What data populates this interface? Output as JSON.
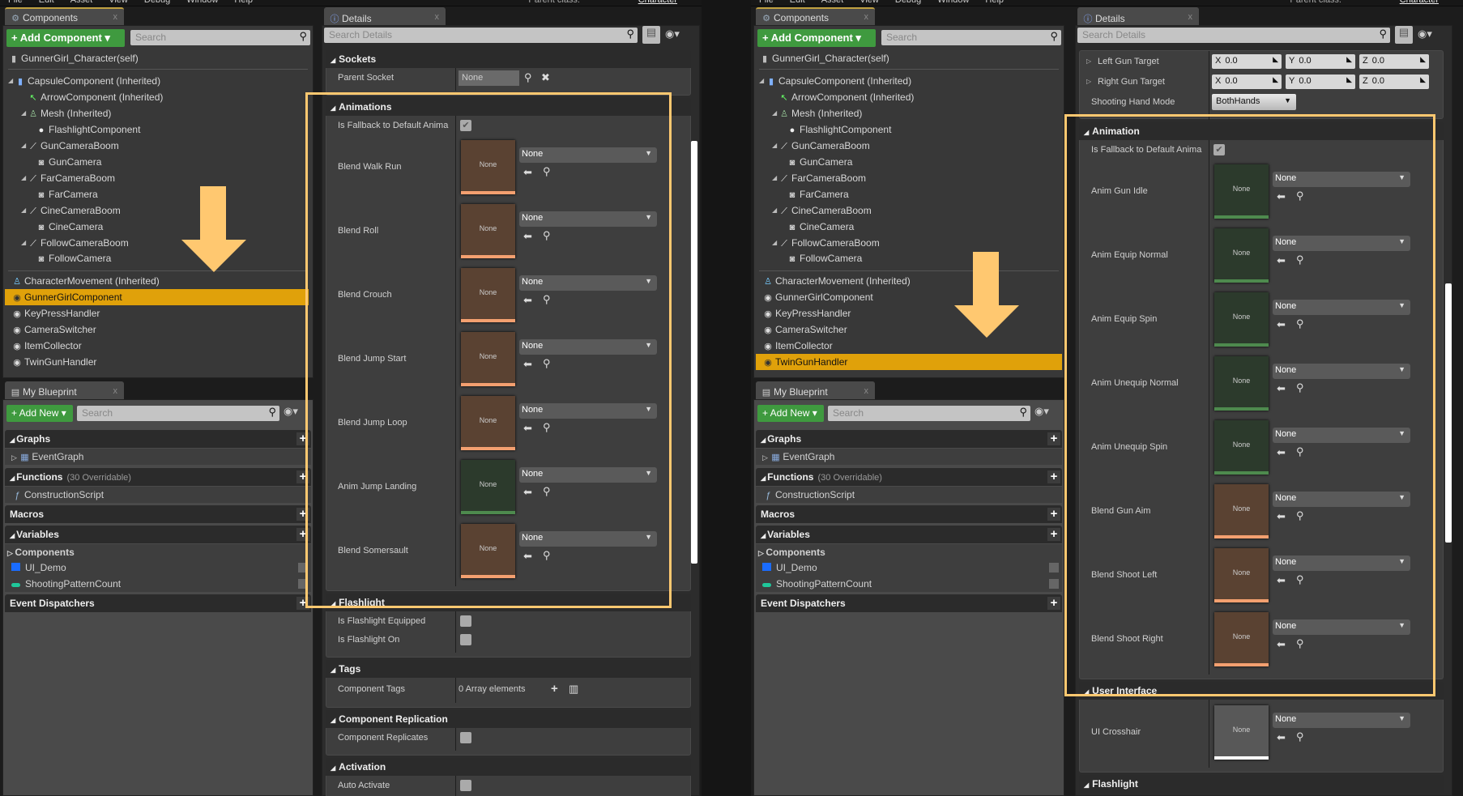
{
  "colors": {
    "highlight": "#ffc870",
    "selection": "#e0a10a",
    "add_button": "#3f9a3f",
    "blendspace_thumb": "#5a4232",
    "blendspace_bar": "#f4a070",
    "animsequence_thumb": "#2c3a2c",
    "animsequence_bar": "#4e8a4e",
    "texture_thumb": "#585858",
    "texture_bar": "#ffffff"
  },
  "windows": [
    {
      "menu": [
        "File",
        "Edit",
        "Asset",
        "View",
        "Debug",
        "Window",
        "Help"
      ],
      "parent_class_label": "Parent class:",
      "parent_class": "Character",
      "components": {
        "tab": "Components",
        "close": "x",
        "add_label": "+ Add Component ▾",
        "search_placeholder": "Search",
        "self": "GunnerGirl_Character(self)",
        "selected": "GunnerGirlComponent",
        "tree": [
          {
            "label": "CapsuleComponent (Inherited)",
            "level": 0,
            "expander": true,
            "icon": "capsule-icon"
          },
          {
            "label": "ArrowComponent (Inherited)",
            "level": 1,
            "expander": false,
            "icon": "arrow-component-icon"
          },
          {
            "label": "Mesh (Inherited)",
            "level": 1,
            "expander": true,
            "icon": "mesh-icon"
          },
          {
            "label": "FlashlightComponent",
            "level": 2,
            "expander": false,
            "icon": "light-icon"
          },
          {
            "label": "GunCameraBoom",
            "level": 1,
            "expander": true,
            "icon": "spring-arm-icon"
          },
          {
            "label": "GunCamera",
            "level": 2,
            "expander": false,
            "icon": "camera-icon"
          },
          {
            "label": "FarCameraBoom",
            "level": 1,
            "expander": true,
            "icon": "spring-arm-icon"
          },
          {
            "label": "FarCamera",
            "level": 2,
            "expander": false,
            "icon": "camera-icon"
          },
          {
            "label": "CineCameraBoom",
            "level": 1,
            "expander": true,
            "icon": "spring-arm-icon"
          },
          {
            "label": "CineCamera",
            "level": 2,
            "expander": false,
            "icon": "camera-icon"
          },
          {
            "label": "FollowCameraBoom",
            "level": 1,
            "expander": true,
            "icon": "spring-arm-icon"
          },
          {
            "label": "FollowCamera",
            "level": 2,
            "expander": false,
            "icon": "camera-icon"
          }
        ],
        "actor_components": [
          {
            "label": "CharacterMovement (Inherited)",
            "icon": "movement-icon"
          },
          {
            "label": "GunnerGirlComponent",
            "icon": "actor-component-icon"
          },
          {
            "label": "KeyPressHandler",
            "icon": "actor-component-icon"
          },
          {
            "label": "CameraSwitcher",
            "icon": "actor-component-icon"
          },
          {
            "label": "ItemCollector",
            "icon": "actor-component-icon"
          },
          {
            "label": "TwinGunHandler",
            "icon": "actor-component-icon"
          }
        ]
      },
      "blueprint": {
        "tab": "My Blueprint",
        "close": "x",
        "add_label": "+ Add New ▾",
        "search_placeholder": "Search",
        "graphs": "Graphs",
        "event_graph": "EventGraph",
        "functions": "Functions",
        "functions_note": "(30 Overridable)",
        "construction_script": "ConstructionScript",
        "macros": "Macros",
        "variables": "Variables",
        "components_category": "Components",
        "vars": [
          {
            "label": "UI_Demo",
            "color": "#1a6cff"
          },
          {
            "label": "ShootingPatternCount",
            "color": "#1fc79a"
          }
        ],
        "event_dispatchers": "Event Dispatchers"
      },
      "details": {
        "tab": "Details",
        "close": "x",
        "search_placeholder": "Search Details",
        "top_rows": [],
        "sections": [
          {
            "title": "Sockets",
            "rows": [
              {
                "type": "socket",
                "label": "Parent Socket",
                "value": "None"
              }
            ]
          },
          {
            "title": "Animations",
            "rows": [
              {
                "type": "check",
                "label": "Is Fallback to Default Anima",
                "checked": true
              },
              {
                "type": "asset",
                "label": "Blend Walk Run",
                "kind": "blendspace",
                "thumb": "None",
                "value": "None"
              },
              {
                "type": "asset",
                "label": "Blend Roll",
                "kind": "blendspace",
                "thumb": "None",
                "value": "None"
              },
              {
                "type": "asset",
                "label": "Blend Crouch",
                "kind": "blendspace",
                "thumb": "None",
                "value": "None"
              },
              {
                "type": "asset",
                "label": "Blend Jump Start",
                "kind": "blendspace",
                "thumb": "None",
                "value": "None"
              },
              {
                "type": "asset",
                "label": "Blend Jump Loop",
                "kind": "blendspace",
                "thumb": "None",
                "value": "None"
              },
              {
                "type": "asset",
                "label": "Anim Jump Landing",
                "kind": "animsequence",
                "thumb": "None",
                "value": "None"
              },
              {
                "type": "asset",
                "label": "Blend Somersault",
                "kind": "blendspace",
                "thumb": "None",
                "value": "None"
              }
            ]
          },
          {
            "title": "Flashlight",
            "rows": [
              {
                "type": "check",
                "label": "Is Flashlight Equipped",
                "checked": false
              },
              {
                "type": "check",
                "label": "Is Flashlight On",
                "checked": false
              }
            ]
          },
          {
            "title": "Tags",
            "rows": [
              {
                "type": "array",
                "label": "Component Tags",
                "value": "0 Array elements"
              }
            ]
          },
          {
            "title": "Component Replication",
            "rows": [
              {
                "type": "check",
                "label": "Component Replicates",
                "checked": false
              }
            ]
          },
          {
            "title": "Activation",
            "rows": [
              {
                "type": "check",
                "label": "Auto Activate",
                "checked": false
              }
            ]
          }
        ]
      }
    },
    {
      "menu": [
        "File",
        "Edit",
        "Asset",
        "View",
        "Debug",
        "Window",
        "Help"
      ],
      "parent_class_label": "Parent class:",
      "parent_class": "Character",
      "components": {
        "tab": "Components",
        "close": "x",
        "add_label": "+ Add Component ▾",
        "search_placeholder": "Search",
        "self": "GunnerGirl_Character(self)",
        "selected": "TwinGunHandler",
        "tree": [
          {
            "label": "CapsuleComponent (Inherited)",
            "level": 0,
            "expander": true,
            "icon": "capsule-icon"
          },
          {
            "label": "ArrowComponent (Inherited)",
            "level": 1,
            "expander": false,
            "icon": "arrow-component-icon"
          },
          {
            "label": "Mesh (Inherited)",
            "level": 1,
            "expander": true,
            "icon": "mesh-icon"
          },
          {
            "label": "FlashlightComponent",
            "level": 2,
            "expander": false,
            "icon": "light-icon"
          },
          {
            "label": "GunCameraBoom",
            "level": 1,
            "expander": true,
            "icon": "spring-arm-icon"
          },
          {
            "label": "GunCamera",
            "level": 2,
            "expander": false,
            "icon": "camera-icon"
          },
          {
            "label": "FarCameraBoom",
            "level": 1,
            "expander": true,
            "icon": "spring-arm-icon"
          },
          {
            "label": "FarCamera",
            "level": 2,
            "expander": false,
            "icon": "camera-icon"
          },
          {
            "label": "CineCameraBoom",
            "level": 1,
            "expander": true,
            "icon": "spring-arm-icon"
          },
          {
            "label": "CineCamera",
            "level": 2,
            "expander": false,
            "icon": "camera-icon"
          },
          {
            "label": "FollowCameraBoom",
            "level": 1,
            "expander": true,
            "icon": "spring-arm-icon"
          },
          {
            "label": "FollowCamera",
            "level": 2,
            "expander": false,
            "icon": "camera-icon"
          }
        ],
        "actor_components": [
          {
            "label": "CharacterMovement (Inherited)",
            "icon": "movement-icon"
          },
          {
            "label": "GunnerGirlComponent",
            "icon": "actor-component-icon"
          },
          {
            "label": "KeyPressHandler",
            "icon": "actor-component-icon"
          },
          {
            "label": "CameraSwitcher",
            "icon": "actor-component-icon"
          },
          {
            "label": "ItemCollector",
            "icon": "actor-component-icon"
          },
          {
            "label": "TwinGunHandler",
            "icon": "actor-component-icon"
          }
        ]
      },
      "blueprint": {
        "tab": "My Blueprint",
        "close": "x",
        "add_label": "+ Add New ▾",
        "search_placeholder": "Search",
        "graphs": "Graphs",
        "event_graph": "EventGraph",
        "functions": "Functions",
        "functions_note": "(30 Overridable)",
        "construction_script": "ConstructionScript",
        "macros": "Macros",
        "variables": "Variables",
        "components_category": "Components",
        "vars": [
          {
            "label": "UI_Demo",
            "color": "#1a6cff"
          },
          {
            "label": "ShootingPatternCount",
            "color": "#1fc79a"
          }
        ],
        "event_dispatchers": "Event Dispatchers"
      },
      "details": {
        "tab": "Details",
        "close": "x",
        "search_placeholder": "Search Details",
        "top_rows": [
          {
            "type": "vector",
            "label": "Left Gun Target",
            "x": "0.0",
            "y": "0.0",
            "z": "0.0"
          },
          {
            "type": "vector",
            "label": "Right Gun Target",
            "x": "0.0",
            "y": "0.0",
            "z": "0.0"
          },
          {
            "type": "enum",
            "label": "Shooting Hand Mode",
            "value": "BothHands"
          }
        ],
        "sections": [
          {
            "title": "Animation",
            "rows": [
              {
                "type": "check",
                "label": "Is Fallback to Default Anima",
                "checked": true
              },
              {
                "type": "asset",
                "label": "Anim Gun Idle",
                "kind": "animsequence",
                "thumb": "None",
                "value": "None"
              },
              {
                "type": "asset",
                "label": "Anim Equip Normal",
                "kind": "animsequence",
                "thumb": "None",
                "value": "None"
              },
              {
                "type": "asset",
                "label": "Anim Equip Spin",
                "kind": "animsequence",
                "thumb": "None",
                "value": "None"
              },
              {
                "type": "asset",
                "label": "Anim Unequip Normal",
                "kind": "animsequence",
                "thumb": "None",
                "value": "None"
              },
              {
                "type": "asset",
                "label": "Anim Unequip Spin",
                "kind": "animsequence",
                "thumb": "None",
                "value": "None"
              },
              {
                "type": "asset",
                "label": "Blend Gun Aim",
                "kind": "blendspace",
                "thumb": "None",
                "value": "None"
              },
              {
                "type": "asset",
                "label": "Blend Shoot Left",
                "kind": "blendspace",
                "thumb": "None",
                "value": "None"
              },
              {
                "type": "asset",
                "label": "Blend Shoot Right",
                "kind": "blendspace",
                "thumb": "None",
                "value": "None"
              }
            ]
          },
          {
            "title": "User Interface",
            "rows": [
              {
                "type": "asset",
                "label": "UI Crosshair",
                "kind": "texture",
                "thumb": "None",
                "value": "None"
              }
            ]
          },
          {
            "title": "Flashlight",
            "rows": []
          }
        ]
      }
    }
  ]
}
